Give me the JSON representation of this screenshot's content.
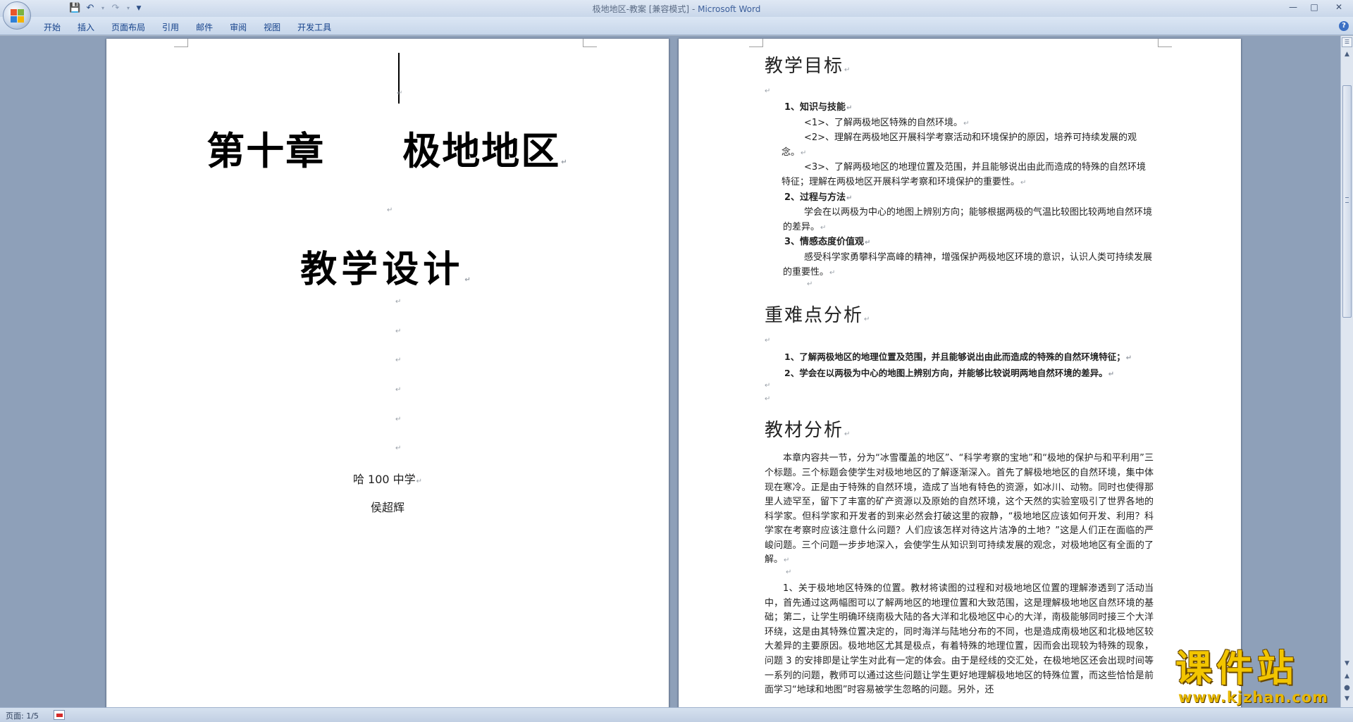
{
  "titlebar": {
    "document_name": "极地地区-教案 [兼容模式]",
    "separator": " - ",
    "app_name": "Microsoft Word",
    "qat_icons": [
      "save-icon",
      "undo-icon",
      "redo-icon",
      "customize-icon"
    ],
    "window_controls": [
      "—",
      "□",
      "✕"
    ]
  },
  "ribbon": {
    "tabs": [
      "开始",
      "插入",
      "页面布局",
      "引用",
      "邮件",
      "审阅",
      "视图",
      "开发工具"
    ],
    "help": "?"
  },
  "page1": {
    "chapter_left": "第十章",
    "chapter_right": "极地地区",
    "design_title": "教学设计",
    "school": "哈 100 中学",
    "author": "侯超辉",
    "para_mark": "↵"
  },
  "page2": {
    "section1": {
      "heading": "教学目标",
      "items": [
        {
          "text": "1、知识与技能",
          "bold": true,
          "indent": 1
        },
        {
          "text": "<1>、了解两极地区特殊的自然环境。",
          "bold": false,
          "indent": 2
        },
        {
          "text": "<2>、理解在两极地区开展科学考察活动和环境保护的原因，培养可持续发展的观念。",
          "bold": false,
          "indent": 2
        },
        {
          "text": "<3>、了解两极地区的地理位置及范围，并且能够说出由此而造成的特殊的自然环境特征；理解在两极地区开展科学考察和环境保护的重要性。",
          "bold": false,
          "indent": 2
        },
        {
          "text": "2、过程与方法",
          "bold": true,
          "indent": 1
        },
        {
          "text": "学会在以两极为中心的地图上辨别方向；能够根据两极的气温比较图比较两地自然环境的差异。",
          "bold": false,
          "indent": 1
        },
        {
          "text": "3、情感态度价值观",
          "bold": true,
          "indent": 1
        },
        {
          "text": "感受科学家勇攀科学高峰的精神，增强保护两极地区环境的意识，认识人类可持续发展的重要性。",
          "bold": false,
          "indent": 1
        }
      ]
    },
    "section2": {
      "heading": "重难点分析",
      "items": [
        "1、了解两极地区的地理位置及范围，并且能够说出由此而造成的特殊的自然环境特征；",
        "2、学会在以两极为中心的地图上辨别方向，并能够比较说明两地自然环境的差异。"
      ]
    },
    "section3": {
      "heading": "教材分析",
      "para1": "本章内容共一节，分为“冰雪覆盖的地区”、“科学考察的宝地”和“极地的保护与和平利用”三个标题。三个标题会使学生对极地地区的了解逐渐深入。首先了解极地地区的自然环境，集中体现在寒冷。正是由于特殊的自然环境，造成了当地有特色的资源，如冰川、动物。同时也使得那里人迹罕至，留下了丰富的矿产资源以及原始的自然环境，这个天然的实验室吸引了世界各地的科学家。但科学家和开发者的到来必然会打破这里的寂静，“极地地区应该如何开发、利用？科学家在考察时应该注意什么问题？人们应该怎样对待这片洁净的土地？”这是人们正在面临的严峻问题。三个问题一步步地深入，会使学生从知识到可持续发展的观念，对极地地区有全面的了解。",
      "para2": "1、关于极地地区特殊的位置。教材将读图的过程和对极地地区位置的理解渗透到了活动当中，首先通过这两幅图可以了解两地区的地理位置和大致范围，这是理解极地地区自然环境的基础；第二，让学生明确环绕南极大陆的各大洋和北极地区中心的大洋，南极能够同时接三个大洋环绕，这是由其特殊位置决定的，同时海洋与陆地分布的不同，也是造成南极地区和北极地区较大差异的主要原因。极地地区尤其是极点，有着特殊的地理位置，因而会出现较为特殊的现象，问题 3 的安排即是让学生对此有一定的体会。由于是经线的交汇处，在极地地区还会出现时间等一系列的问题，教师可以通过这些问题让学生更好地理解极地地区的特殊位置，而这些恰恰是前面学习“地球和地图”时容易被学生忽略的问题。另外，还"
    }
  },
  "statusbar": {
    "page": "页面: 1/5"
  },
  "watermark": {
    "cn": "课件站",
    "url": "www.kjzhan.com"
  },
  "colors": {
    "ribbon_text": "#15428b",
    "workspace": "#8ea0b9",
    "watermark_yellow": "#f2c500"
  }
}
